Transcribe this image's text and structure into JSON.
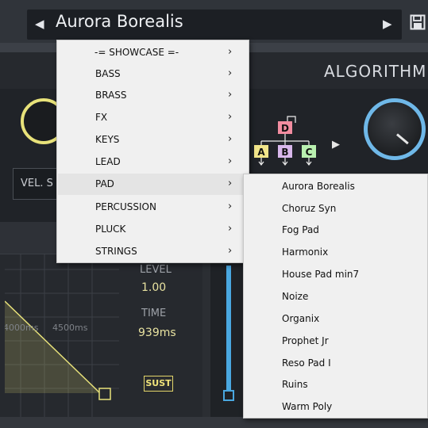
{
  "preset": {
    "name": "Aurora Borealis",
    "prev_glyph": "◀",
    "next_glyph": "▶",
    "save_icon": "save-icon"
  },
  "header": {
    "algorithm_title": "ALGORITHM"
  },
  "controls": {
    "vel_label": "VEL. S"
  },
  "algorithm_diagram": {
    "operators": [
      "D",
      "A",
      "B",
      "C"
    ],
    "colors": {
      "D": "#f28ca0",
      "A": "#f1e58a",
      "B": "#d9b8ec",
      "C": "#b9f0b0"
    }
  },
  "envelope": {
    "level_label": "LEVEL",
    "level_value": "1.00",
    "time_label": "TIME",
    "time_value": "939ms",
    "sust_label": "SUST",
    "axis_labels": [
      "4000ms",
      "4500ms"
    ],
    "accent": "#e8e27a"
  },
  "menu": {
    "items": [
      {
        "label": "-= SHOWCASE =-",
        "arrow": "›"
      },
      {
        "label": "BASS",
        "arrow": "›"
      },
      {
        "label": "BRASS",
        "arrow": "›"
      },
      {
        "label": "FX",
        "arrow": "›"
      },
      {
        "label": "KEYS",
        "arrow": "›"
      },
      {
        "label": "LEAD",
        "arrow": "›"
      },
      {
        "label": "PAD",
        "arrow": "›"
      },
      {
        "label": "PERCUSSION",
        "arrow": "›"
      },
      {
        "label": "PLUCK",
        "arrow": "›"
      },
      {
        "label": "STRINGS",
        "arrow": "›"
      }
    ],
    "highlighted": "PAD"
  },
  "submenu": {
    "items": [
      "Aurora Borealis",
      "Choruz Syn",
      "Fog Pad",
      "Harmonix",
      "House Pad min7",
      "Noize",
      "Organix",
      "Prophet Jr",
      "Reso Pad I",
      "Ruins",
      "Warm Poly"
    ]
  },
  "colors": {
    "knob_left": "#e8e27a",
    "knob_right": "#6fb8e8"
  }
}
